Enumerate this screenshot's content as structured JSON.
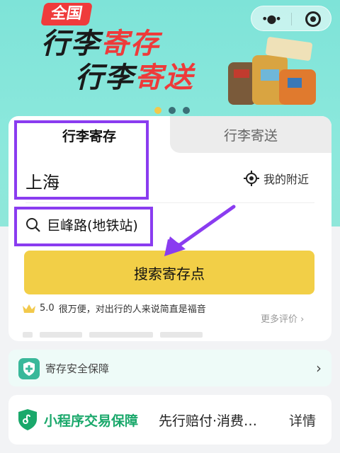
{
  "banner": {
    "badge": "全国",
    "line1_a": "行李",
    "line1_b": "寄存",
    "line2_a": "行李",
    "line2_b": "寄送"
  },
  "tabs": {
    "active": "行李寄存",
    "inactive": "行李寄送"
  },
  "location": {
    "city": "上海",
    "nearby": "我的附近"
  },
  "search": {
    "value": "巨峰路(地铁站)",
    "button": "搜索寄存点"
  },
  "review": {
    "rating": "5.0",
    "text": "很万便，对出行的人来说简直是福音",
    "more": "更多评价"
  },
  "security": {
    "label": "寄存安全保障"
  },
  "guarantee": {
    "title": "小程序交易保障",
    "desc": "先行赔付·消费…",
    "detail": "详情"
  },
  "colors": {
    "accent_yellow": "#f2cf47",
    "brand_red": "#ee3a3a",
    "annotation_purple": "#8a3cf0",
    "green": "#1aa86b"
  }
}
